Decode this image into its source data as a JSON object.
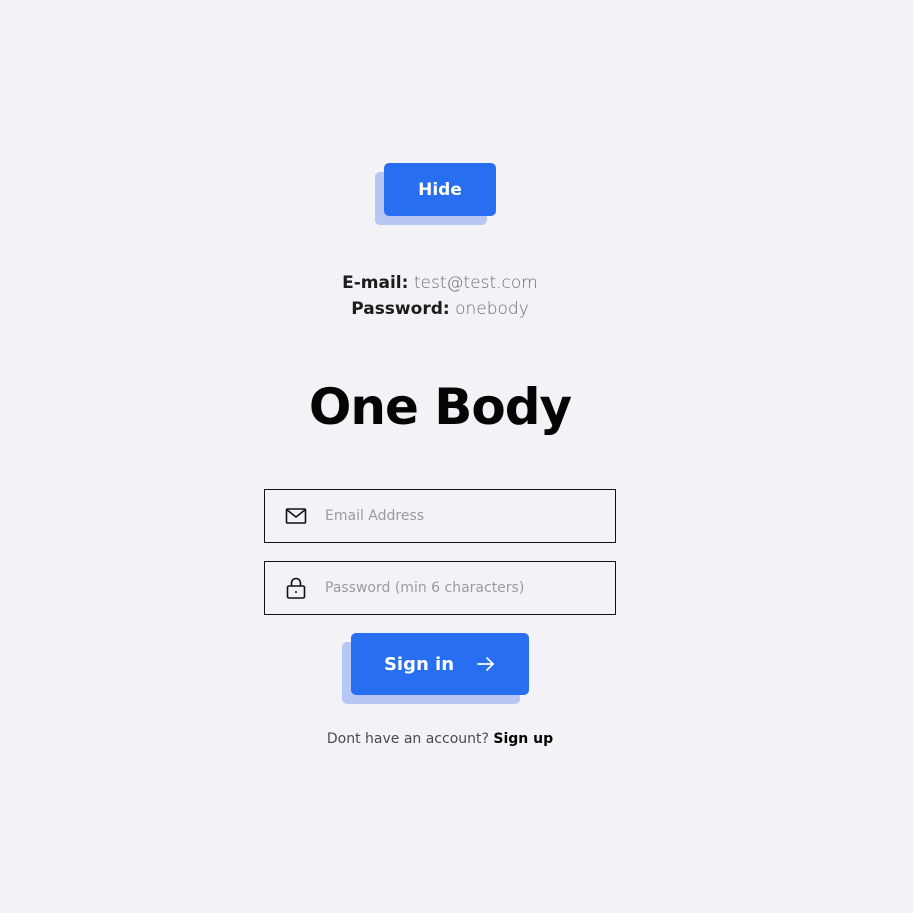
{
  "hide_button": {
    "label": "Hide"
  },
  "credentials": {
    "email_label": "E-mail:",
    "email_value": "test@test.com",
    "password_label": "Password:",
    "password_value": "onebody"
  },
  "title": "One Body",
  "form": {
    "email": {
      "placeholder": "Email Address",
      "value": "",
      "icon": "mail-icon"
    },
    "password": {
      "placeholder": "Password (min 6 characters)",
      "value": "",
      "icon": "lock-icon"
    },
    "submit": {
      "label": "Sign in",
      "icon": "arrow-right-icon"
    }
  },
  "footer": {
    "prompt": "Dont have an account?",
    "link_label": "Sign up"
  },
  "colors": {
    "background": "#f3f2f7",
    "primary": "#276ff0",
    "primary_shadow": "#b5c7f2",
    "text": "#050505"
  }
}
